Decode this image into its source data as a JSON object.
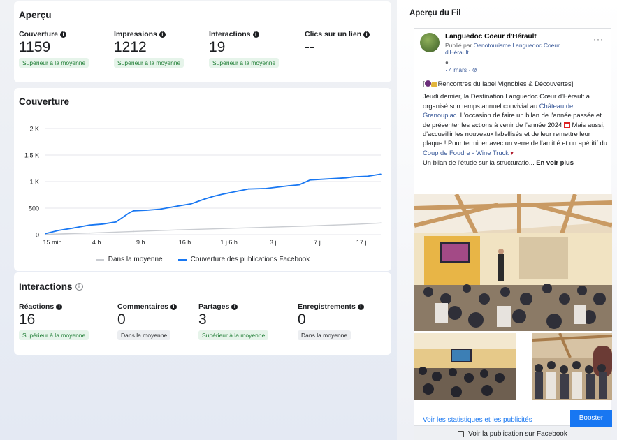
{
  "apercu": {
    "title": "Aperçu",
    "metrics": [
      {
        "label": "Couverture",
        "value": "1159",
        "badge": "Supérieur à la moyenne"
      },
      {
        "label": "Impressions",
        "value": "1212",
        "badge": "Supérieur à la moyenne"
      },
      {
        "label": "Interactions",
        "value": "19",
        "badge": "Supérieur à la moyenne"
      },
      {
        "label": "Clics sur un lien",
        "value": "--",
        "badge": ""
      }
    ]
  },
  "couverture_chart": {
    "title": "Couverture",
    "legend_avg": "Dans la moyenne",
    "legend_fb": "Couverture des publications Facebook"
  },
  "chart_data": {
    "type": "line",
    "title": "Couverture",
    "xlabel": "",
    "ylabel": "",
    "x_ticks": [
      "15 min",
      "4 h",
      "9 h",
      "16 h",
      "1 j 6 h",
      "3 j",
      "7 j",
      "17 j"
    ],
    "y_ticks": [
      "0",
      "500",
      "1 K",
      "1,5 K",
      "2 K"
    ],
    "ylim": [
      0,
      2000
    ],
    "grid": true,
    "legend_position": "bottom",
    "series": [
      {
        "name": "Couverture des publications Facebook",
        "color": "#1877f2",
        "x": [
          0.0,
          0.3,
          0.6,
          1.0,
          1.3,
          1.6,
          1.9,
          2.0,
          2.3,
          2.6,
          3.0,
          3.3,
          3.6,
          3.8,
          4.0,
          4.3,
          4.6,
          5.0,
          5.2,
          5.5,
          5.75,
          6.0,
          6.4,
          6.8,
          7.0,
          7.3,
          7.6
        ],
        "values": [
          20,
          80,
          120,
          180,
          200,
          240,
          410,
          450,
          460,
          480,
          540,
          580,
          670,
          720,
          760,
          810,
          860,
          870,
          890,
          920,
          940,
          1030,
          1050,
          1070,
          1090,
          1100,
          1140
        ]
      },
      {
        "name": "Dans la moyenne",
        "color": "#c9ccd1",
        "x": [
          0.0,
          1.0,
          2.0,
          3.0,
          4.0,
          5.0,
          6.0,
          7.0,
          7.6
        ],
        "values": [
          5,
          30,
          60,
          90,
          115,
          140,
          165,
          195,
          220
        ]
      }
    ]
  },
  "interactions": {
    "title": "Interactions",
    "metrics": [
      {
        "label": "Réactions",
        "value": "16",
        "badge": "Supérieur à la moyenne",
        "tone": "good"
      },
      {
        "label": "Commentaires",
        "value": "0",
        "badge": "Dans la moyenne",
        "tone": "neutral"
      },
      {
        "label": "Partages",
        "value": "3",
        "badge": "Supérieur à la moyenne",
        "tone": "good"
      },
      {
        "label": "Enregistrements",
        "value": "0",
        "badge": "Dans la moyenne",
        "tone": "neutral"
      }
    ]
  },
  "fil": {
    "title": "Aperçu du Fil",
    "page_name": "Languedoc Coeur d'Hérault",
    "published_by_prefix": "Publié par ",
    "published_by_link": "Oenotourisme Languedoc Coeur d'Hérault",
    "date": "· 4 mars · ",
    "more": "···",
    "heading": "Rencontres du label Vignobles & Découvertes]",
    "heading_prefix": "[",
    "p1_a": "Jeudi dernier, la Destination Languedoc Cœur d'Hérault a organisé son temps annuel convivial au ",
    "p1_link": "Château de Granoupiac",
    "p1_b": ". L'occasion de faire un bilan de l'année passée et de présenter les actions à venir de l'année 2024 ",
    "p1_c": " Mais aussi, d'accueillir les nouveaux labellisés et de leur remettre leur plaque ! Pour terminer avec un verre de l'amitié et un apéritif du ",
    "p1_link2": "Coup de Foudre - Wine Truck",
    "p2": "Un bilan de l'étude sur la structuratio...",
    "see_more": "En voir plus",
    "stats_link": "Voir les statistiques et les publicités",
    "boost": "Booster",
    "view_fb": "Voir la publication sur Facebook"
  }
}
